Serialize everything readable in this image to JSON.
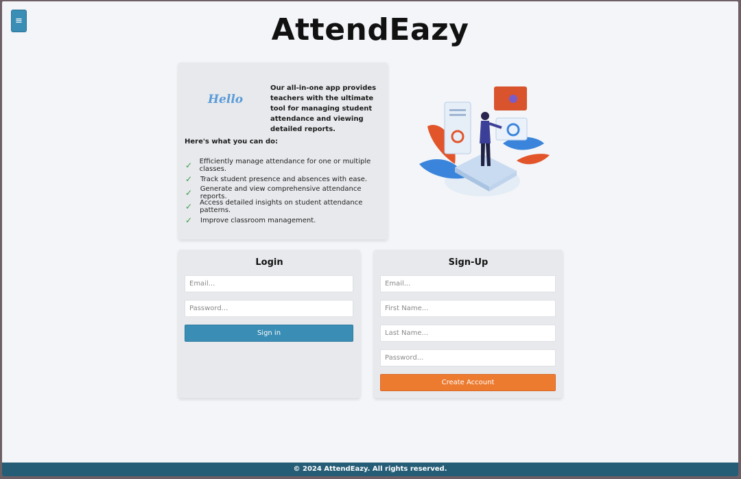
{
  "header": {
    "title": "AttendEazy",
    "menu_icon": "≡"
  },
  "intro": {
    "hello": "Hello",
    "description": "Our all-in-one app provides teachers with the ultimate tool for managing student attendance and viewing detailed reports.",
    "can_do_heading": "Here's what you can do:",
    "features": [
      "Efficiently manage attendance for one or multiple classes.",
      "Track student presence and absences with ease.",
      "Generate and view comprehensive attendance reports.",
      "Access detailed insights on student attendance patterns.",
      "Improve classroom management."
    ]
  },
  "login": {
    "title": "Login",
    "email_placeholder": "Email...",
    "password_placeholder": "Password...",
    "submit_label": "Sign in"
  },
  "signup": {
    "title": "Sign-Up",
    "email_placeholder": "Email...",
    "first_name_placeholder": "First Name...",
    "last_name_placeholder": "Last Name...",
    "password_placeholder": "Password...",
    "submit_label": "Create Account"
  },
  "footer": {
    "text": "© 2024 AttendEazy. All rights reserved."
  },
  "colors": {
    "primary": "#3a8db4",
    "accent": "#ec7a2f",
    "footer": "#265d76"
  }
}
